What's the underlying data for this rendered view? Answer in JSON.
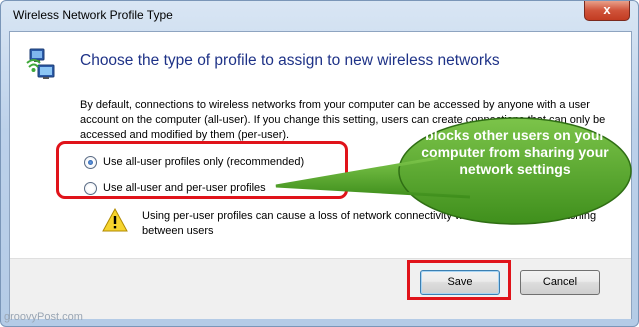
{
  "window": {
    "title": "Wireless Network Profile Type",
    "close_label": "x"
  },
  "dialog": {
    "heading": "Choose the type of profile to assign to new wireless networks",
    "description": "By default, connections to wireless networks from your computer can be accessed by anyone with a user account on the computer (all-user). If you change this setting, users can create connections that can only be accessed and modified by them (per-user).",
    "options": [
      {
        "label": "Use all-user profiles only (recommended)",
        "selected": true
      },
      {
        "label": "Use all-user and per-user profiles",
        "selected": false
      }
    ],
    "warning": "Using per-user profiles can cause a loss of network connectivity when logging off or switching between users",
    "save_label": "Save",
    "cancel_label": "Cancel"
  },
  "annotation": {
    "callout_text": "blocks other users on your computer from sharing your network settings",
    "highlight_color": "#e0131a",
    "callout_color": "#58a72a"
  },
  "watermark": "groovyPost.com",
  "icons": [
    "network-computers-icon",
    "warning-icon",
    "close-icon"
  ]
}
